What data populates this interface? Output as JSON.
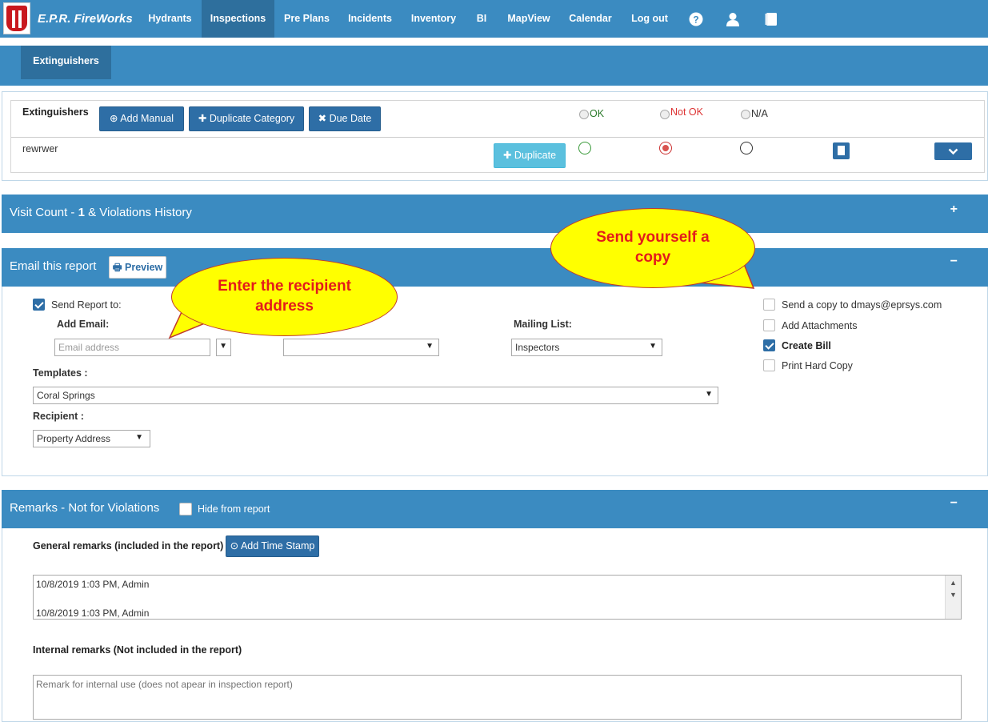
{
  "nav": {
    "brand": "E.P.R. FireWorks",
    "items": [
      "Hydrants",
      "Inspections",
      "Pre Plans",
      "Incidents",
      "Inventory",
      "BI",
      "MapView",
      "Calendar",
      "Log out"
    ]
  },
  "subnav": {
    "tab": "Extinguishers"
  },
  "extinguishers": {
    "heading": "Extinguishers",
    "add_manual": "Add Manual",
    "duplicate_category": "Duplicate Category",
    "due_date": "Due Date",
    "col_ok": "OK",
    "col_not_ok": "Not OK",
    "col_na": "N/A",
    "row_name": "rewrwer",
    "row_duplicate": "Duplicate",
    "row_status": "Not OK"
  },
  "visit": {
    "prefix": "Visit Count - ",
    "count": "1",
    "suffix": " & Violations History",
    "toggle": "+"
  },
  "email": {
    "title": "Email this report",
    "preview": "Preview",
    "toggle": "−",
    "send_report_to": "Send Report to:",
    "add_email": "Add Email:",
    "email_placeholder": "Email address",
    "mailing_list_label": "Mailing List:",
    "mailing_list_value": "Inspectors",
    "templates_label": "Templates :",
    "templates_value": "Coral Springs",
    "recipient_label": "Recipient :",
    "recipient_value": "Property Address",
    "send_copy": "Send a copy to dmays@eprsys.com",
    "add_attachments": "Add Attachments",
    "create_bill": "Create Bill",
    "print_hard_copy": "Print Hard Copy"
  },
  "remarks": {
    "title": "Remarks - Not for Violations",
    "hide_from_report": "Hide from report",
    "toggle": "−",
    "general_label": "General remarks (included in the report)",
    "add_time_stamp": "Add Time Stamp",
    "general_lines": [
      "10/8/2019 1:03 PM, Admin",
      "10/8/2019 1:03 PM, Admin"
    ],
    "internal_label": "Internal remarks (Not included in the report)",
    "internal_placeholder": "Remark for internal use (does not apear in inspection report)"
  },
  "callouts": {
    "recipient": "Enter the recipient address",
    "copy": "Send yourself a copy"
  },
  "colors": {
    "nav": "#3b8bc1",
    "active": "#2e6f9d",
    "button": "#2e6ea6",
    "callout": "#ffff00",
    "callout_text": "#e31b1b"
  }
}
